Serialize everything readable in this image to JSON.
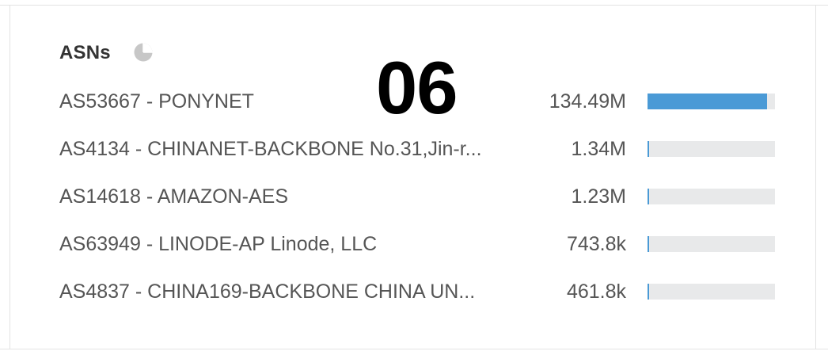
{
  "card": {
    "title": "ASNs",
    "title_icon": "pie-chart-icon"
  },
  "overlay_number": "06",
  "accent_color": "#4a9ad6",
  "track_color": "#e8e9ea",
  "rows": [
    {
      "label": "AS53667 - PONYNET",
      "value": "134.49M",
      "fraction": 0.94
    },
    {
      "label": "AS4134 - CHINANET-BACKBONE No.31,Jin-r...",
      "value": "1.34M",
      "fraction": 0.01
    },
    {
      "label": "AS14618 - AMAZON-AES",
      "value": "1.23M",
      "fraction": 0.009
    },
    {
      "label": "AS63949 - LINODE-AP Linode, LLC",
      "value": "743.8k",
      "fraction": 0.0055
    },
    {
      "label": "AS4837 - CHINA169-BACKBONE CHINA UN...",
      "value": "461.8k",
      "fraction": 0.0034
    }
  ]
}
